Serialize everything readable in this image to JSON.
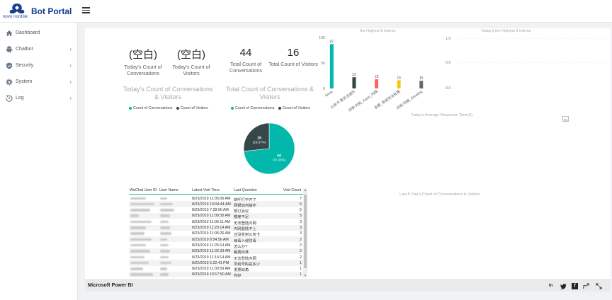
{
  "app": {
    "brand": "Bot Portal",
    "logo_text": "novo nordisk"
  },
  "sidebar": {
    "items": [
      {
        "label": "Dashboard",
        "icon": "home-icon",
        "has_chevron": false
      },
      {
        "label": "Chatbot",
        "icon": "android-icon",
        "has_chevron": true
      },
      {
        "label": "Security",
        "icon": "shield-icon",
        "has_chevron": true
      },
      {
        "label": "System",
        "icon": "gear-icon",
        "has_chevron": true
      },
      {
        "label": "Log",
        "icon": "history-icon",
        "has_chevron": true
      }
    ]
  },
  "kpis": [
    {
      "value": "(空白)",
      "label": "Today's Count of Conversations"
    },
    {
      "value": "(空白)",
      "label": "Today's Count of Visitors"
    },
    {
      "value": "44",
      "label": "Total Count of Conversations"
    },
    {
      "value": "16",
      "label": "Total Count of Visitors"
    }
  ],
  "today_chart": {
    "title": "Today's Count of Conversations & Visitors",
    "legend": [
      "Count of Conversations",
      "Count of Visitors"
    ]
  },
  "total_chart": {
    "title": "Total Count of Conversations & Visitors",
    "legend": [
      "Count of Conversations",
      "Count of Visitors"
    ]
  },
  "colors": {
    "conversations": "#01b8aa",
    "visitors": "#374649",
    "bar3": "#fd625e",
    "bar4": "#f2c80f",
    "bar5": "#5f6b6d",
    "brand": "#0b3b8f"
  },
  "pie": {
    "slices": [
      {
        "name": "Count of Conversations",
        "value": 44,
        "label": "44",
        "pct": "(73.33%)"
      },
      {
        "name": "Count of Visitors",
        "value": 16,
        "label": "16",
        "pct": "(26.67%)"
      }
    ]
  },
  "chart_data": {
    "type": "bar",
    "title": "the Highest 5 Intents",
    "categories": [
      "None",
      "公务卡 我无法挂件",
      "问候 何处_Assis_内网",
      "发票_系统无法处理",
      "问候 问候_Greeting"
    ],
    "values": [
      87,
      22,
      18,
      16,
      15
    ],
    "ylim": [
      0,
      100
    ],
    "yticks": [
      "0",
      "50",
      "100"
    ],
    "colors": [
      "#01b8aa",
      "#374649",
      "#fd625e",
      "#f2c80f",
      "#5f6b6d"
    ]
  },
  "today_intents": {
    "title": "Today's the Highest 5 Intents",
    "yticks": [
      "0.0",
      "0.5",
      "1.0"
    ]
  },
  "titles": {
    "avg_response": "Today's Average Response Time(S)",
    "last5": "Last 5 Day's Count of Conversations & Visitors"
  },
  "table": {
    "headers": [
      "WeChat User ID",
      "User Name",
      "Latest Visit Time",
      "Last Question",
      "Visit Count"
    ],
    "rows": [
      {
        "time": "8/23/2019 11:05:06 AM",
        "question": "能吁打不开了",
        "count": "7"
      },
      {
        "time": "8/23/2019 10:04:44 AM",
        "question": "网银如何操作",
        "count": "6"
      },
      {
        "time": "8/23/2019 7:28:00 AM",
        "question": "预订会议",
        "count": "5"
      },
      {
        "time": "8/23/2019 11:08:30 AM",
        "question": "额度不足",
        "count": "5"
      },
      {
        "time": "8/23/2019 11:06:11 AM",
        "question": "无法登陆内网",
        "count": "3"
      },
      {
        "time": "8/23/2019 11:20:14 AM",
        "question": "内网登陆不上",
        "count": "3"
      },
      {
        "time": "8/23/2019 11:05:26 AM",
        "question": "还没收到公务卡",
        "count": "3"
      },
      {
        "time": "8/23/2019 8:54:56 AM",
        "question": "病毒入侵防毒",
        "count": "2"
      },
      {
        "time": "8/23/2019 11:26:14 AM",
        "question": "怎么办?",
        "count": "2"
      },
      {
        "time": "8/23/2019 11:02:33 AM",
        "question": "餐费标准",
        "count": "2"
      },
      {
        "time": "8/23/2019 11:14:14 AM",
        "question": "无法登陆内网",
        "count": "2"
      },
      {
        "time": "8/22/2019 5:22:41 PM",
        "question": "员线号码是多少",
        "count": "1"
      },
      {
        "time": "8/23/2019 11:00:59 AM",
        "question": "发票缺角",
        "count": "1"
      },
      {
        "time": "8/23/2019 10:17:50 AM",
        "question": "你好",
        "count": "1"
      }
    ]
  },
  "footer": {
    "brand": "Microsoft Power BI",
    "icons": [
      "linkedin-icon",
      "twitter-icon",
      "facebook-icon",
      "share-icon",
      "fullscreen-icon"
    ]
  }
}
